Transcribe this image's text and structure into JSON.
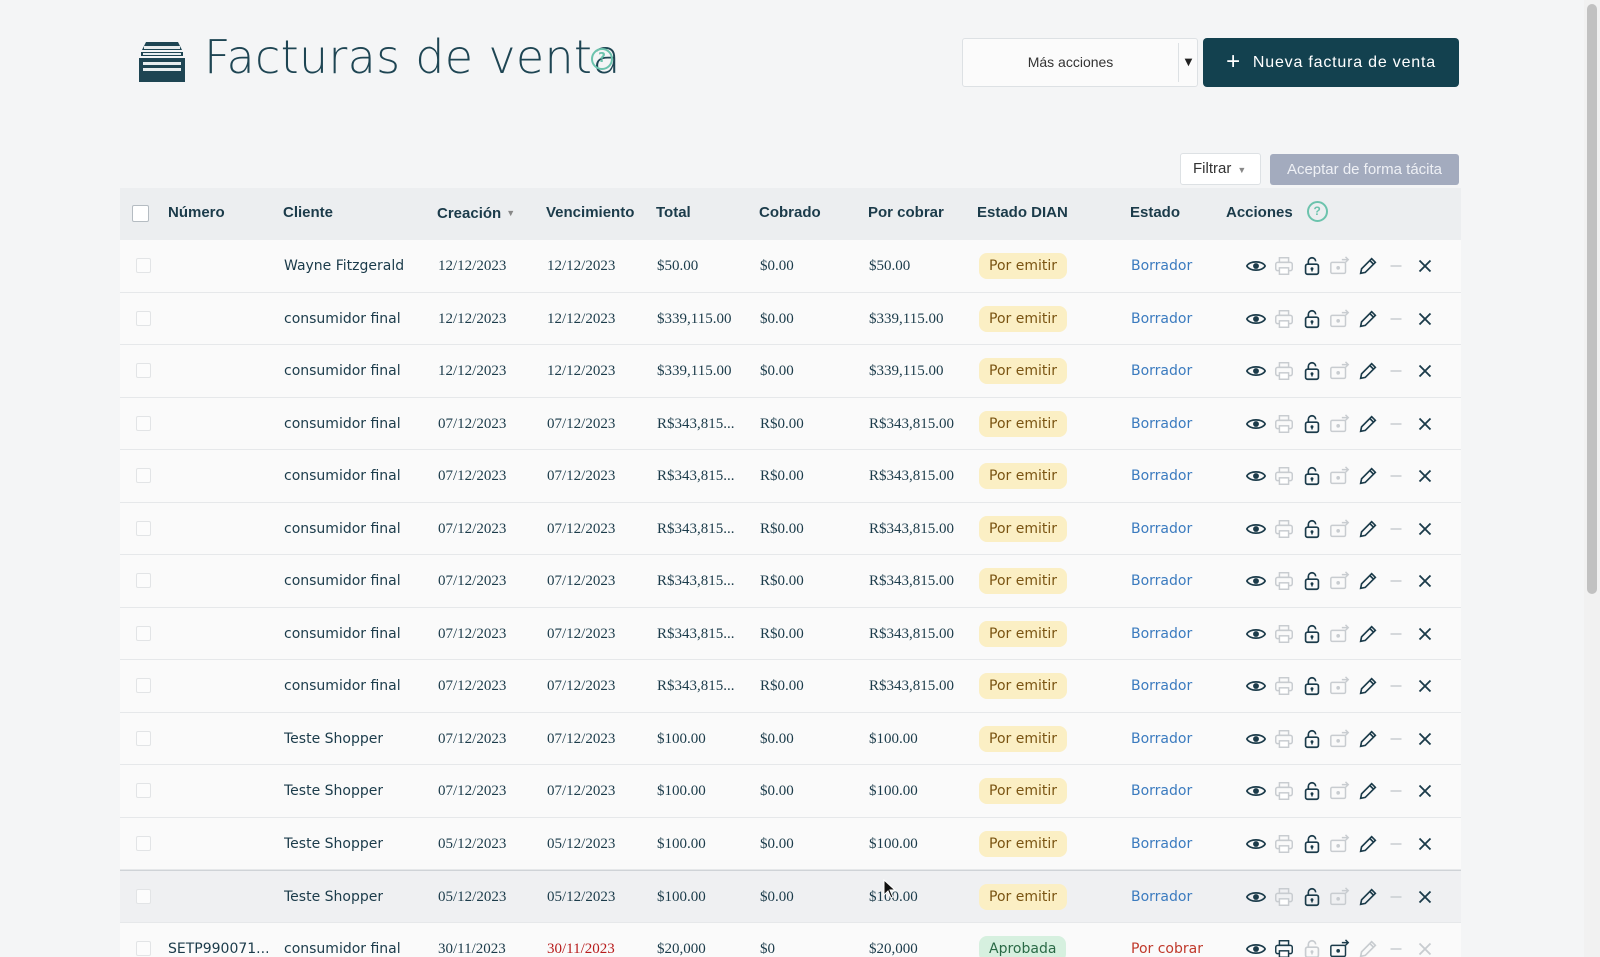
{
  "header": {
    "title": "Facturas de venta",
    "help": "?",
    "more_actions_label": "Más acciones",
    "new_invoice_label": "Nueva factura de venta",
    "new_invoice_plus": "+",
    "icon": "inbox-tray-icon"
  },
  "toolbar": {
    "filter_label": "Filtrar",
    "accept_label": "Aceptar de forma tácita"
  },
  "table": {
    "columns": {
      "number": "Número",
      "client": "Cliente",
      "created": "Creación",
      "due": "Vencimiento",
      "total": "Total",
      "collected": "Cobrado",
      "receivable": "Por cobrar",
      "dian_status": "Estado DIAN",
      "status": "Estado",
      "actions": "Acciones",
      "actions_help": "?"
    },
    "sorted_column": "Creación",
    "rows": [
      {
        "number": "",
        "client": "Wayne Fitzgerald",
        "created": "12/12/2023",
        "due": "12/12/2023",
        "total": "$50.00",
        "collected": "$0.00",
        "receivable": "$50.00",
        "dian": "Por emitir",
        "status": "Borrador"
      },
      {
        "number": "",
        "client": "consumidor final",
        "created": "12/12/2023",
        "due": "12/12/2023",
        "total": "$339,115.00",
        "collected": "$0.00",
        "receivable": "$339,115.00",
        "dian": "Por emitir",
        "status": "Borrador"
      },
      {
        "number": "",
        "client": "consumidor final",
        "created": "12/12/2023",
        "due": "12/12/2023",
        "total": "$339,115.00",
        "collected": "$0.00",
        "receivable": "$339,115.00",
        "dian": "Por emitir",
        "status": "Borrador"
      },
      {
        "number": "",
        "client": "consumidor final",
        "created": "07/12/2023",
        "due": "07/12/2023",
        "total": "R$343,815...",
        "collected": "R$0.00",
        "receivable": "R$343,815.00",
        "dian": "Por emitir",
        "status": "Borrador"
      },
      {
        "number": "",
        "client": "consumidor final",
        "created": "07/12/2023",
        "due": "07/12/2023",
        "total": "R$343,815...",
        "collected": "R$0.00",
        "receivable": "R$343,815.00",
        "dian": "Por emitir",
        "status": "Borrador"
      },
      {
        "number": "",
        "client": "consumidor final",
        "created": "07/12/2023",
        "due": "07/12/2023",
        "total": "R$343,815...",
        "collected": "R$0.00",
        "receivable": "R$343,815.00",
        "dian": "Por emitir",
        "status": "Borrador"
      },
      {
        "number": "",
        "client": "consumidor final",
        "created": "07/12/2023",
        "due": "07/12/2023",
        "total": "R$343,815...",
        "collected": "R$0.00",
        "receivable": "R$343,815.00",
        "dian": "Por emitir",
        "status": "Borrador"
      },
      {
        "number": "",
        "client": "consumidor final",
        "created": "07/12/2023",
        "due": "07/12/2023",
        "total": "R$343,815...",
        "collected": "R$0.00",
        "receivable": "R$343,815.00",
        "dian": "Por emitir",
        "status": "Borrador"
      },
      {
        "number": "",
        "client": "consumidor final",
        "created": "07/12/2023",
        "due": "07/12/2023",
        "total": "R$343,815...",
        "collected": "R$0.00",
        "receivable": "R$343,815.00",
        "dian": "Por emitir",
        "status": "Borrador"
      },
      {
        "number": "",
        "client": "Teste Shopper",
        "created": "07/12/2023",
        "due": "07/12/2023",
        "total": "$100.00",
        "collected": "$0.00",
        "receivable": "$100.00",
        "dian": "Por emitir",
        "status": "Borrador"
      },
      {
        "number": "",
        "client": "Teste Shopper",
        "created": "07/12/2023",
        "due": "07/12/2023",
        "total": "$100.00",
        "collected": "$0.00",
        "receivable": "$100.00",
        "dian": "Por emitir",
        "status": "Borrador"
      },
      {
        "number": "",
        "client": "Teste Shopper",
        "created": "05/12/2023",
        "due": "05/12/2023",
        "total": "$100.00",
        "collected": "$0.00",
        "receivable": "$100.00",
        "dian": "Por emitir",
        "status": "Borrador"
      },
      {
        "number": "",
        "client": "Teste Shopper",
        "created": "05/12/2023",
        "due": "05/12/2023",
        "total": "$100.00",
        "collected": "$0.00",
        "receivable": "$100.00",
        "dian": "Por emitir",
        "status": "Borrador",
        "hover": true
      },
      {
        "number": "SETP990071...",
        "client": "consumidor final",
        "created": "30/11/2023",
        "due": "30/11/2023",
        "total": "$20,000",
        "collected": "$0",
        "receivable": "$20,000",
        "dian": "Aprobada",
        "status": "Por cobrar",
        "overdue": true
      }
    ]
  },
  "row_actions": [
    "view-icon",
    "print-icon",
    "unlock-icon",
    "send-payment-icon",
    "edit-icon",
    "minus-icon",
    "close-icon"
  ],
  "colors": {
    "brand": "#13414f",
    "help": "#6cc3ad",
    "draft_link": "#3b7bbf",
    "overdue": "#b71c1c",
    "pending_badge_bg": "#fbefc4",
    "approved_badge_bg": "#d6f0df"
  }
}
